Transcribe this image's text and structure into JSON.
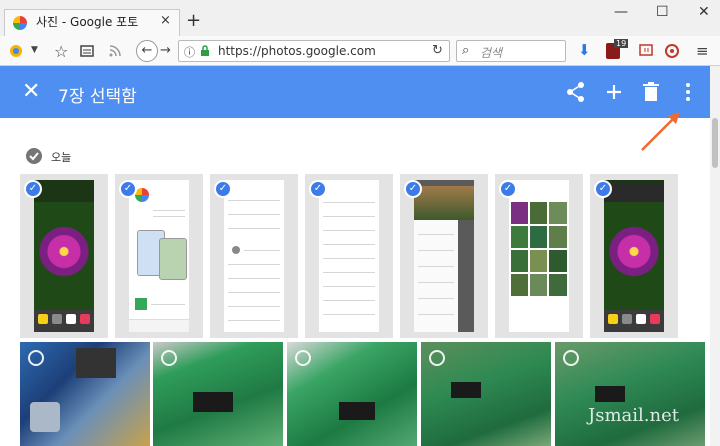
{
  "browser": {
    "tab_title": "사진 - Google 포토",
    "tab_close": "×",
    "new_tab": "+",
    "url": "https://photos.google.com",
    "search_placeholder": "검색",
    "badge_count": "19",
    "window_controls": [
      "—",
      "☐",
      "✕"
    ]
  },
  "appbar": {
    "close_icon": "✕",
    "title": "7장 선택함",
    "actions": [
      "share-icon",
      "add-icon",
      "delete-icon",
      "more-vert-icon"
    ],
    "color": "#4f8ff1"
  },
  "section": {
    "label": "오늘"
  },
  "selected_items": [
    {
      "kind": "flower-screenshot"
    },
    {
      "kind": "app-store-screenshot"
    },
    {
      "kind": "settings-screenshot"
    },
    {
      "kind": "settings-list-screenshot"
    },
    {
      "kind": "menu-screenshot"
    },
    {
      "kind": "photo-grid-screenshot"
    },
    {
      "kind": "flower-screenshot"
    }
  ],
  "photos": [
    {
      "kind": "circuit-board-blue"
    },
    {
      "kind": "circuit-board-green"
    },
    {
      "kind": "circuit-board-green"
    },
    {
      "kind": "circuit-board-green"
    },
    {
      "kind": "circuit-board-green"
    }
  ],
  "watermark": "Jsmail.net",
  "colors": {
    "accent": "#4f8ff1",
    "check": "#3d7be9",
    "arrow": "#f26a2e"
  }
}
